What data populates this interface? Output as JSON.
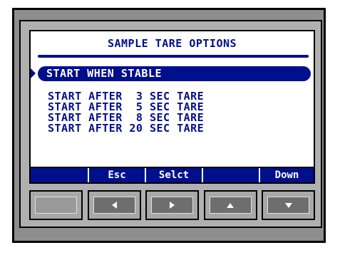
{
  "screen": {
    "title": "SAMPLE TARE OPTIONS",
    "selected_option": "START WHEN STABLE",
    "options": [
      "START AFTER  3 SEC TARE",
      "START AFTER  5 SEC TARE",
      "START AFTER  8 SEC TARE",
      "START AFTER 20 SEC TARE"
    ]
  },
  "softkeys": [
    "",
    "Esc",
    "Selct",
    "",
    "Down"
  ],
  "hardware_keys": [
    {
      "icon": "blank-key"
    },
    {
      "icon": "arrow-left-icon"
    },
    {
      "icon": "arrow-right-icon"
    },
    {
      "icon": "arrow-up-icon"
    },
    {
      "icon": "arrow-down-icon"
    }
  ],
  "colors": {
    "lcd_text": "#000f8c",
    "lcd_background": "#ffffff",
    "bezel": "#8e8e8e"
  }
}
